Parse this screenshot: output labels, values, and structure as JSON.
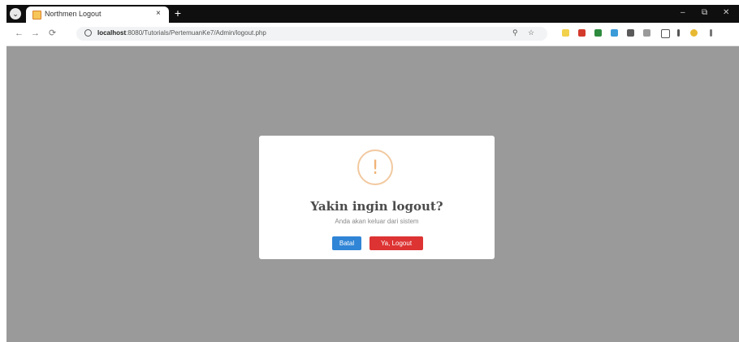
{
  "browser": {
    "tab_title": "Northmen Logout",
    "tab_close": "×",
    "new_tab": "+",
    "url_host": "localhost",
    "url_path": ":8080/Tutorials/PertemuanKe7/Admin/logout.php",
    "window_controls": [
      "–",
      "⧉",
      "✕"
    ],
    "nav": [
      "←",
      "→",
      "⟳"
    ]
  },
  "dialog": {
    "icon_glyph": "!",
    "title": "Yakin ingin logout?",
    "text": "Anda akan keluar dari sistem",
    "cancel_label": "Batal",
    "confirm_label": "Ya, Logout"
  },
  "colors": {
    "overlay": "#9a9a9a",
    "cancel_button": "#3085d6",
    "confirm_button": "#dd3333",
    "warning_icon": "#f0b478"
  }
}
